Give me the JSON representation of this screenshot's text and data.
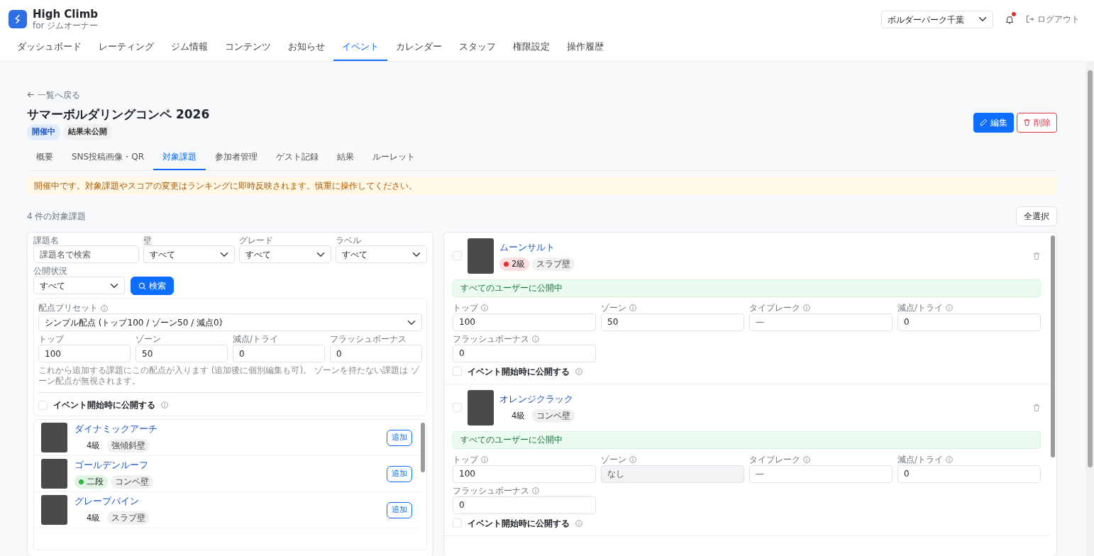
{
  "app": {
    "name": "High Climb",
    "subtitle": "for ジムオーナー"
  },
  "gym_select": {
    "value": "ボルダーパーク千葉"
  },
  "notifications": {
    "unread": true
  },
  "logout": "ログアウト",
  "nav": [
    {
      "label": "ダッシュボード",
      "selected": false
    },
    {
      "label": "レーティング",
      "selected": false
    },
    {
      "label": "ジム情報",
      "selected": false
    },
    {
      "label": "コンテンツ",
      "selected": false
    },
    {
      "label": "お知らせ",
      "selected": false
    },
    {
      "label": "イベント",
      "selected": true
    },
    {
      "label": "カレンダー",
      "selected": false
    },
    {
      "label": "スタッフ",
      "selected": false
    },
    {
      "label": "権限設定",
      "selected": false
    },
    {
      "label": "操作履歴",
      "selected": false
    }
  ],
  "back_link": "一覧へ戻る",
  "event": {
    "title": "サマーボルダリングコンペ 2026",
    "badges": [
      {
        "label": "開催中",
        "kind": "status"
      },
      {
        "label": "結果未公開",
        "kind": "plain"
      }
    ]
  },
  "actions": [
    {
      "label": "編集",
      "kind": "primary"
    },
    {
      "label": "削除",
      "kind": "danger"
    }
  ],
  "tabs": [
    {
      "label": "概要",
      "selected": false
    },
    {
      "label": "SNS投稿画像・QR",
      "selected": false
    },
    {
      "label": "対象課題",
      "selected": true
    },
    {
      "label": "参加者管理",
      "selected": false
    },
    {
      "label": "ゲスト記録",
      "selected": false
    },
    {
      "label": "結果",
      "selected": false
    },
    {
      "label": "ルーレット",
      "selected": false
    }
  ],
  "alert": "開催中です。対象課題やスコアの変更はランキングに即時反映されます。慎重に操作してください。",
  "count_text": "4 件の対象課題",
  "select_all": "全選択",
  "filters": {
    "name": {
      "label": "課題名",
      "placeholder": "課題名で検索"
    },
    "selects": [
      {
        "label": "壁",
        "value": "すべて"
      },
      {
        "label": "グレード",
        "value": "すべて"
      },
      {
        "label": "ラベル",
        "value": "すべて"
      }
    ],
    "status": {
      "label": "公開状況",
      "value": "すべて"
    },
    "search_button": "検索"
  },
  "preset": {
    "label": "配点プリセット",
    "value": "シンプル配点 (トップ100 / ゾーン50 / 減点0)",
    "fields": [
      {
        "label": "トップ",
        "value": "100"
      },
      {
        "label": "ゾーン",
        "value": "50"
      },
      {
        "label": "減点/トライ",
        "value": "0"
      },
      {
        "label": "フラッシュボーナス",
        "value": "0"
      }
    ],
    "help": "これから追加する課題にこの配点が入ります (追加後に個別編集も可)。 ゾーンを持たない課題は ゾーン配点が無視されます。",
    "publish_on_start": {
      "label": "イベント開始時に公開する",
      "checked": false
    }
  },
  "available_problems": [
    {
      "name": "ダイナミックアーチ",
      "grade": "4級",
      "wall": "強傾斜壁",
      "add_label": "追加"
    },
    {
      "name": "ゴールデンルーフ",
      "grade": "二段",
      "color": "#2fb344",
      "wall": "コンペ壁",
      "add_label": "追加"
    },
    {
      "name": "グレープバイン",
      "grade": "4級",
      "wall": "スラブ壁",
      "add_label": "追加"
    }
  ],
  "selected_problems": [
    {
      "name": "ムーンサルト",
      "grade": "2級",
      "color": "#e03131",
      "wall": "スラブ壁",
      "checked": false,
      "visibility": "すべてのユーザーに公開中",
      "fields": [
        {
          "label": "トップ",
          "value": "100",
          "disabled": false
        },
        {
          "label": "ゾーン",
          "value": "50",
          "disabled": false
        },
        {
          "label": "タイブレーク",
          "placeholder": "—",
          "disabled": false
        },
        {
          "label": "減点/トライ",
          "value": "0",
          "disabled": false
        },
        {
          "label": "フラッシュボーナス",
          "value": "0",
          "disabled": false
        }
      ],
      "publish_on_start": {
        "label": "イベント開始時に公開する",
        "checked": false
      }
    },
    {
      "name": "オレンジクラック",
      "grade": "4級",
      "wall": "コンペ壁",
      "checked": false,
      "visibility": "すべてのユーザーに公開中",
      "fields": [
        {
          "label": "トップ",
          "value": "100",
          "disabled": false
        },
        {
          "label": "ゾーン",
          "placeholder": "なし",
          "disabled": true
        },
        {
          "label": "タイブレーク",
          "placeholder": "—",
          "disabled": false
        },
        {
          "label": "減点/トライ",
          "value": "0",
          "disabled": false
        },
        {
          "label": "フラッシュボーナス",
          "value": "0",
          "disabled": false
        }
      ],
      "publish_on_start": {
        "label": "イベント開始時に公開する",
        "checked": false
      }
    }
  ]
}
